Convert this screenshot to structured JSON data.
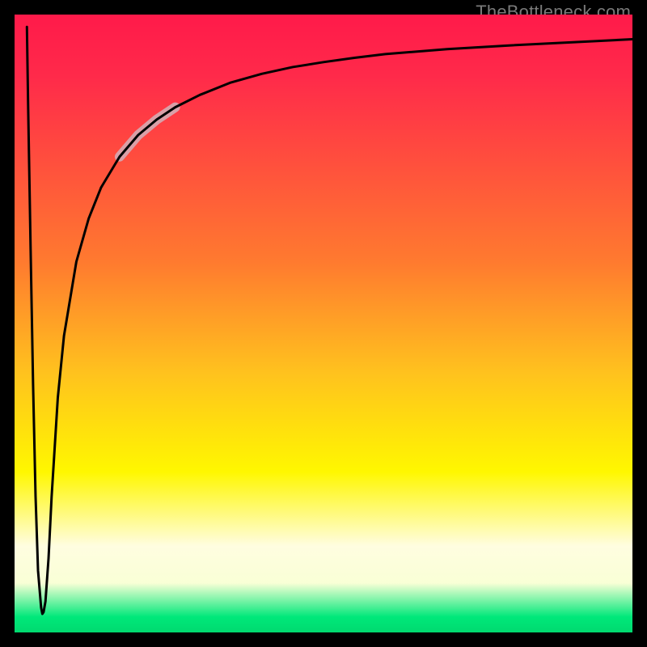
{
  "watermark": "TheBottleneck.com",
  "chart_data": {
    "type": "line",
    "title": "",
    "xlabel": "",
    "ylabel": "",
    "xlim": [
      0,
      100
    ],
    "ylim": [
      0,
      100
    ],
    "grid": false,
    "legend": false,
    "annotations": [],
    "background_gradient": {
      "direction": "top_to_bottom",
      "stops": [
        {
          "pos": 0,
          "color": "#ff1a4a"
        },
        {
          "pos": 22,
          "color": "#ff4a3f"
        },
        {
          "pos": 40,
          "color": "#ff7a2f"
        },
        {
          "pos": 58,
          "color": "#ffc21e"
        },
        {
          "pos": 74,
          "color": "#fff700"
        },
        {
          "pos": 86,
          "color": "#fffde0"
        },
        {
          "pos": 97,
          "color": "#00e87a"
        },
        {
          "pos": 100,
          "color": "#00d96f"
        }
      ]
    },
    "series": [
      {
        "name": "curve",
        "color": "#000000",
        "stroke_width": 3,
        "x": [
          2.0,
          2.2,
          2.6,
          3.0,
          3.4,
          3.8,
          4.3,
          4.5,
          4.7,
          5.0,
          5.5,
          6.0,
          7.0,
          8.0,
          10.0,
          12.0,
          14.0,
          17.0,
          20.0,
          23.0,
          26.0,
          30.0,
          35.0,
          40.0,
          45.0,
          50.0,
          55.0,
          60.0,
          70.0,
          80.0,
          90.0,
          100.0
        ],
        "y": [
          98.0,
          85.0,
          62.0,
          40.0,
          22.0,
          10.0,
          4.0,
          3.0,
          3.3,
          5.0,
          12.0,
          22.0,
          38.0,
          48.0,
          60.0,
          67.0,
          72.0,
          77.0,
          80.5,
          83.0,
          85.0,
          87.0,
          89.0,
          90.4,
          91.5,
          92.3,
          93.0,
          93.6,
          94.4,
          95.0,
          95.5,
          96.0
        ]
      },
      {
        "name": "highlight-segment",
        "color": "#d9a0a8",
        "stroke_width": 12,
        "linecap": "round",
        "x": [
          17.0,
          20.0,
          23.0,
          26.0
        ],
        "y": [
          77.0,
          80.5,
          83.0,
          85.0
        ]
      }
    ]
  }
}
